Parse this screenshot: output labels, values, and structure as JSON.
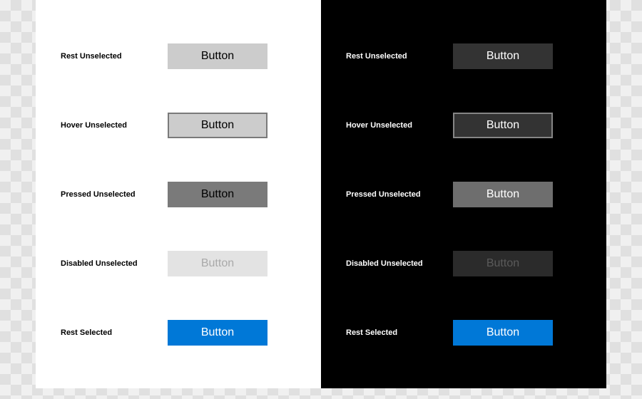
{
  "button_label": "Button",
  "states": {
    "rest_unselected": "Rest Unselected",
    "hover_unselected": "Hover Unselected",
    "pressed_unselected": "Pressed Unselected",
    "disabled_unselected": "Disabled Unselected",
    "rest_selected": "Rest Selected"
  },
  "colors": {
    "accent": "#0078d7",
    "light_bg": "#ffffff",
    "dark_bg": "#000000"
  }
}
